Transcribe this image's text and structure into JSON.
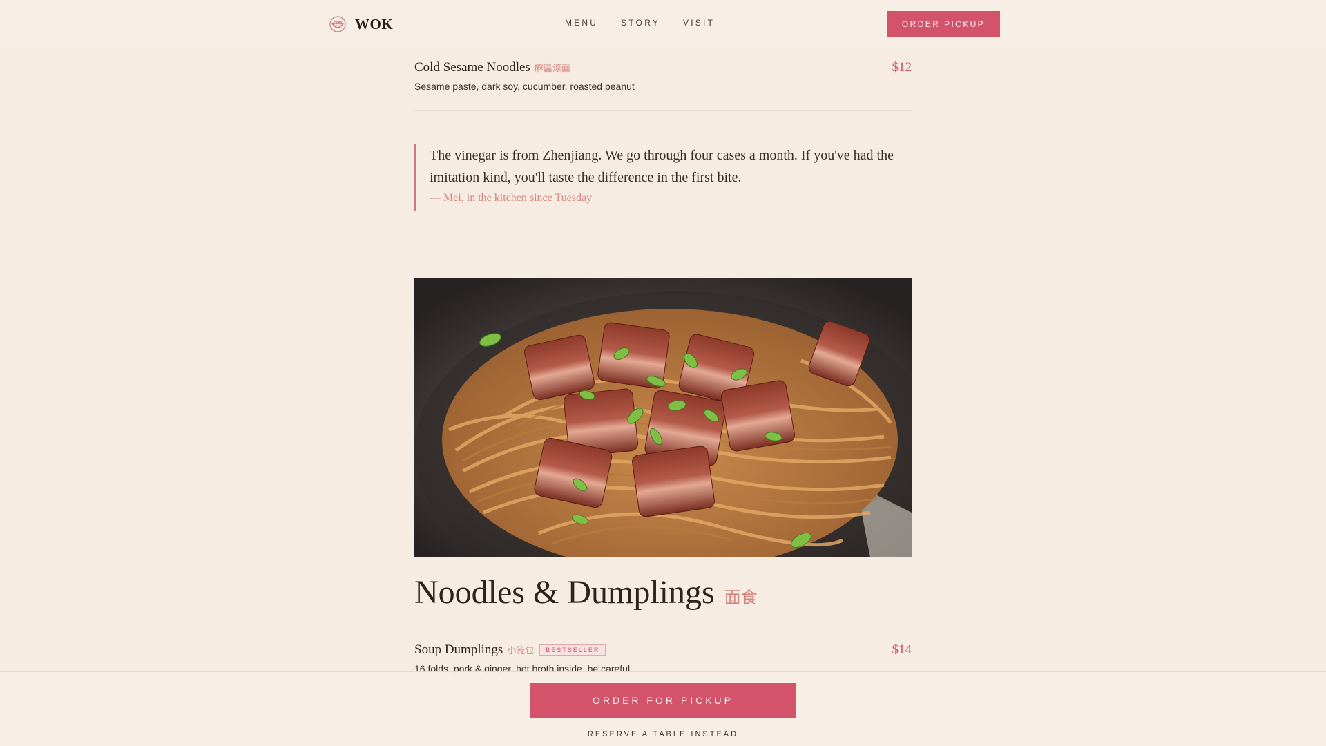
{
  "header": {
    "brand": "WOK",
    "logo_icon": "bowl-icon",
    "nav": [
      {
        "label": "MENU"
      },
      {
        "label": "STORY"
      },
      {
        "label": "VISIT"
      }
    ],
    "cta_label": "ORDER PICKUP"
  },
  "items_top": [
    {
      "name": "Cold Sesame Noodles",
      "cn": "麻醬涼面",
      "price": "$12",
      "desc": "Sesame paste, dark soy, cucumber, roasted peanut"
    }
  ],
  "quote": {
    "text": "The vinegar is from Zhenjiang. We go through four cases a month. If you've had the imitation kind, you'll taste the difference in the first bite.",
    "author": "— Mei, in the kitchen since Tuesday"
  },
  "photo": {
    "icon": "braised-pork-noodles-image"
  },
  "section": {
    "title": "Noodles & Dumplings",
    "cn": "面食"
  },
  "items_section": [
    {
      "name": "Soup Dumplings",
      "cn": "小笼包",
      "badge": "BESTSELLER",
      "price": "$14",
      "desc": "16 folds, pork & ginger, hot broth inside, be careful"
    }
  ],
  "bottom_bar": {
    "cta_label": "ORDER FOR PICKUP",
    "secondary_label": "RESERVE A TABLE INSTEAD"
  },
  "colors": {
    "background": "#f6ece2",
    "accent": "#d3546a",
    "accent_soft": "#d3847f",
    "text": "#2e221c"
  }
}
